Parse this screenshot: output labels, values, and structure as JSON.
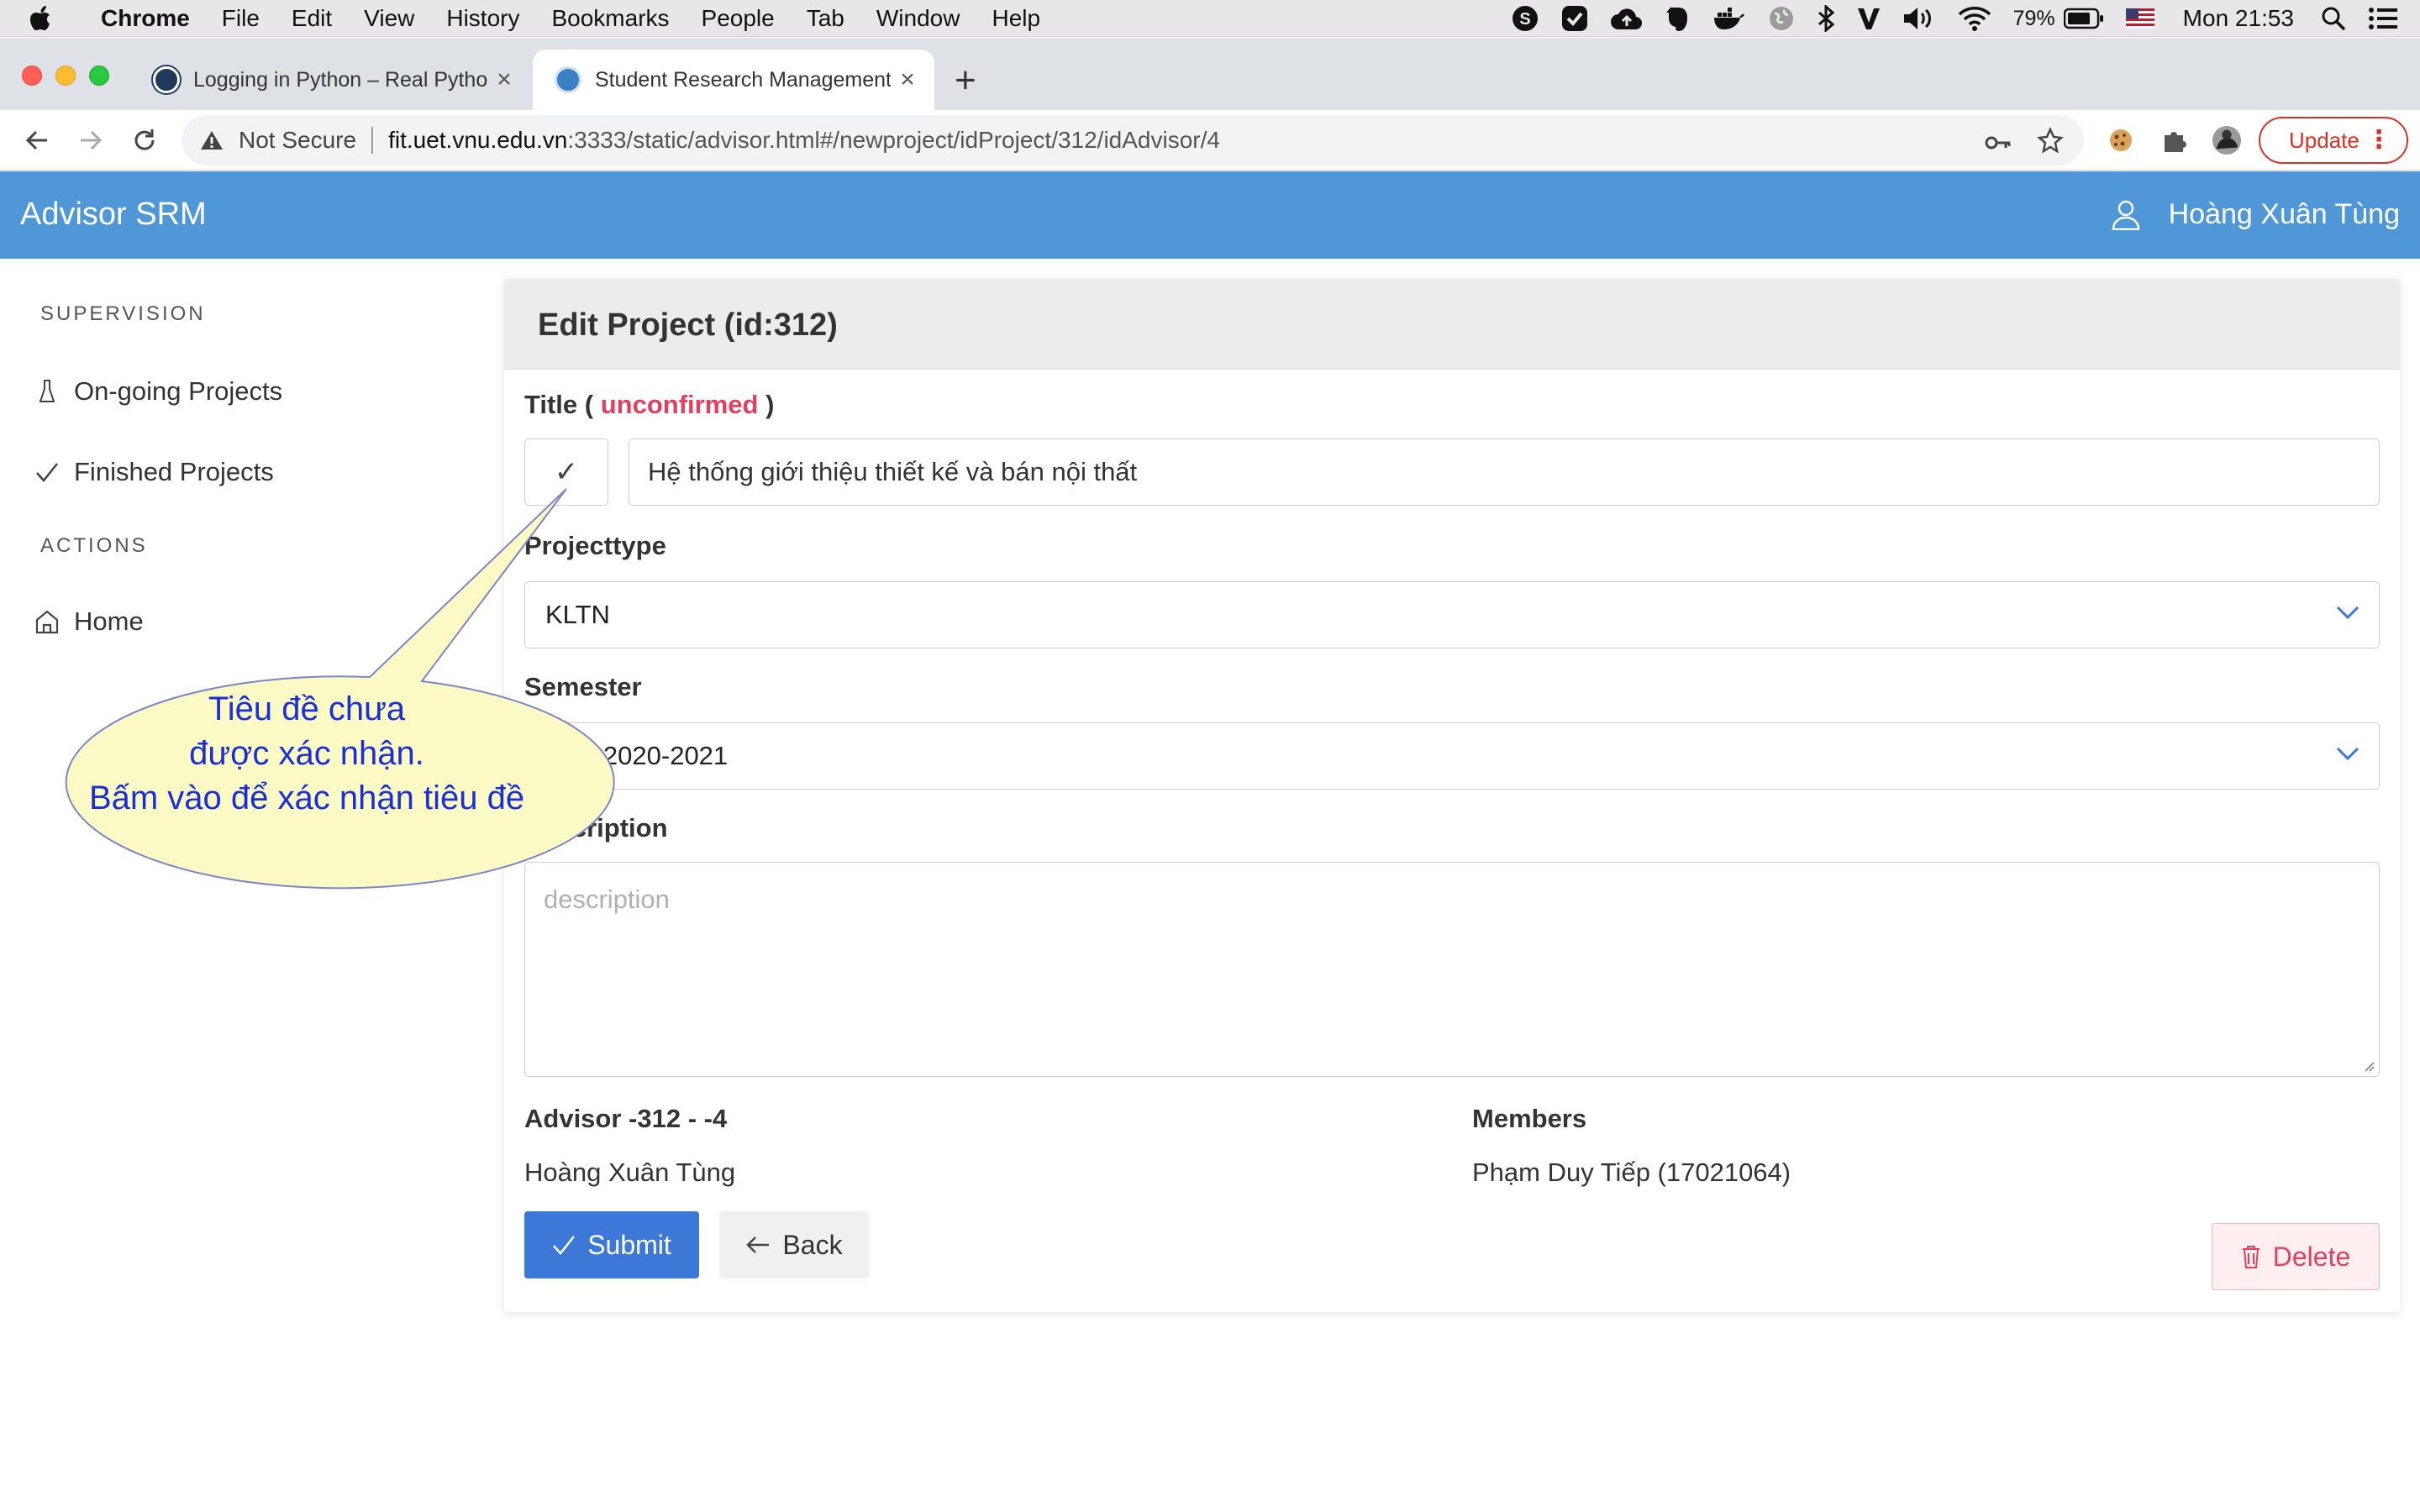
{
  "menubar": {
    "app": "Chrome",
    "items": [
      "File",
      "Edit",
      "View",
      "History",
      "Bookmarks",
      "People",
      "Tab",
      "Window",
      "Help"
    ],
    "battery": "79%",
    "clock": "Mon 21:53"
  },
  "tabs": [
    {
      "title": "Logging in Python – Real Python",
      "active": false
    },
    {
      "title": "Student Research Management",
      "active": true
    }
  ],
  "address": {
    "security_label": "Not Secure",
    "host": "fit.uet.vnu.edu.vn",
    "path": ":3333/static/advisor.html#/newproject/idProject/312/idAdvisor/4",
    "update_label": "Update"
  },
  "app": {
    "brand": "Advisor SRM",
    "user_name": "Hoàng Xuân Tùng"
  },
  "sidebar": {
    "supervision_heading": "SUPERVISION",
    "ongoing": "On-going Projects",
    "finished": "Finished Projects",
    "actions_heading": "ACTIONS",
    "home": "Home"
  },
  "form": {
    "heading": "Edit Project (id:312)",
    "title_label": "Title (",
    "title_status": "unconfirmed",
    "title_label_close": ")",
    "confirm_glyph": "✓",
    "title_value": "Hệ thống giới thiệu thiết kế và bán nội thất",
    "projecttype_label": "Projecttype",
    "projecttype_value": "KLTN",
    "semester_label": "Semester",
    "semester_value": "HK2 2020-2021",
    "description_label": "Description",
    "description_placeholder": "description",
    "advisor_label": "Advisor -312 - -4",
    "advisor_value": "Hoàng Xuân Tùng",
    "members_label": "Members",
    "members_value": "Phạm Duy Tiếp (17021064)",
    "submit_label": "Submit",
    "back_label": "Back",
    "delete_label": "Delete"
  },
  "callout": {
    "line1": "Tiêu đề chưa",
    "line2": "được xác nhận.",
    "line3": "Bấm vào để xác nhận tiêu đề"
  },
  "colors": {
    "appbar": "#4f97d7",
    "unconfirmed": "#e2405f",
    "submit": "#3c78d8",
    "callout_fill": "#fbf9c4",
    "callout_text": "#1a2fd6"
  }
}
